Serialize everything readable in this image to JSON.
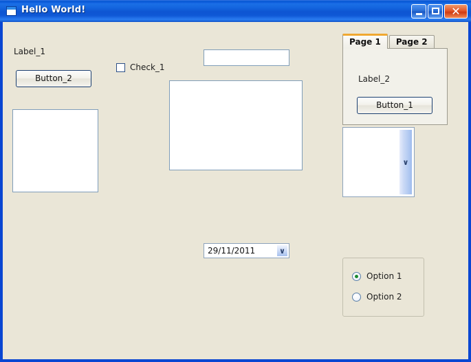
{
  "window": {
    "title": "Hello World!",
    "icon": "window-icon",
    "controls": {
      "minimize": "minimize-button",
      "maximize": "maximize-button",
      "close": "close-button",
      "close_glyph": "✕"
    },
    "colors": {
      "titlebar_blue": "#1567e0",
      "client_background": "#eae6d7",
      "close_button_red": "#e2572a",
      "tab_active_accent": "#f0a830",
      "radio_selected_green": "#1a8a2e",
      "textbox_border": "#7f9db9"
    }
  },
  "controls": {
    "label_1": "Label_1",
    "button_2": "Button_2",
    "checkbox_1": {
      "label": "Check_1",
      "checked": false
    },
    "listbox_left": "",
    "textbox_top": "",
    "textbox_large": "",
    "combo_list": "",
    "combo_chevron": "∨",
    "datepicker": {
      "value": "29/11/2011",
      "chevron": "∨"
    }
  },
  "tabcontrol": {
    "tabs": [
      {
        "label": "Page 1",
        "active": true
      },
      {
        "label": "Page 2",
        "active": false
      }
    ],
    "page1": {
      "label_2": "Label_2",
      "button_1": "Button_1"
    }
  },
  "radiogroup": {
    "options": [
      {
        "label": "Option 1",
        "selected": true
      },
      {
        "label": "Option 2",
        "selected": false
      }
    ]
  }
}
